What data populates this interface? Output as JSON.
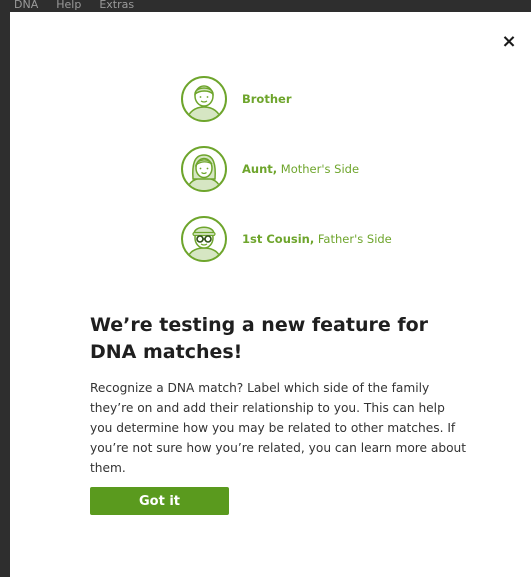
{
  "background": {
    "nav_items": [
      "DNA",
      "Help",
      "Extras"
    ]
  },
  "modal": {
    "close_label": "×",
    "relationships": [
      {
        "label": "Brother",
        "detail": "",
        "icon": "male-person-icon"
      },
      {
        "label": "Aunt,",
        "detail": " Mother's Side",
        "icon": "female-person-icon"
      },
      {
        "label": "1st Cousin,",
        "detail": " Father's Side",
        "icon": "person-with-glasses-and-cap-icon"
      }
    ],
    "headline": "We’re testing a new feature for DNA matches!",
    "body": "Recognize a DNA match? Label which side of the family they’re on and add their relationship to you. This can help you determine how you may be related to other matches. If you’re not sure how you’re related, you can learn more about them.",
    "button_label": "Got it"
  },
  "colors": {
    "accent_green": "#6ea52c",
    "button_green": "#5a9a1e",
    "avatar_fill": "#d6e6c3"
  }
}
